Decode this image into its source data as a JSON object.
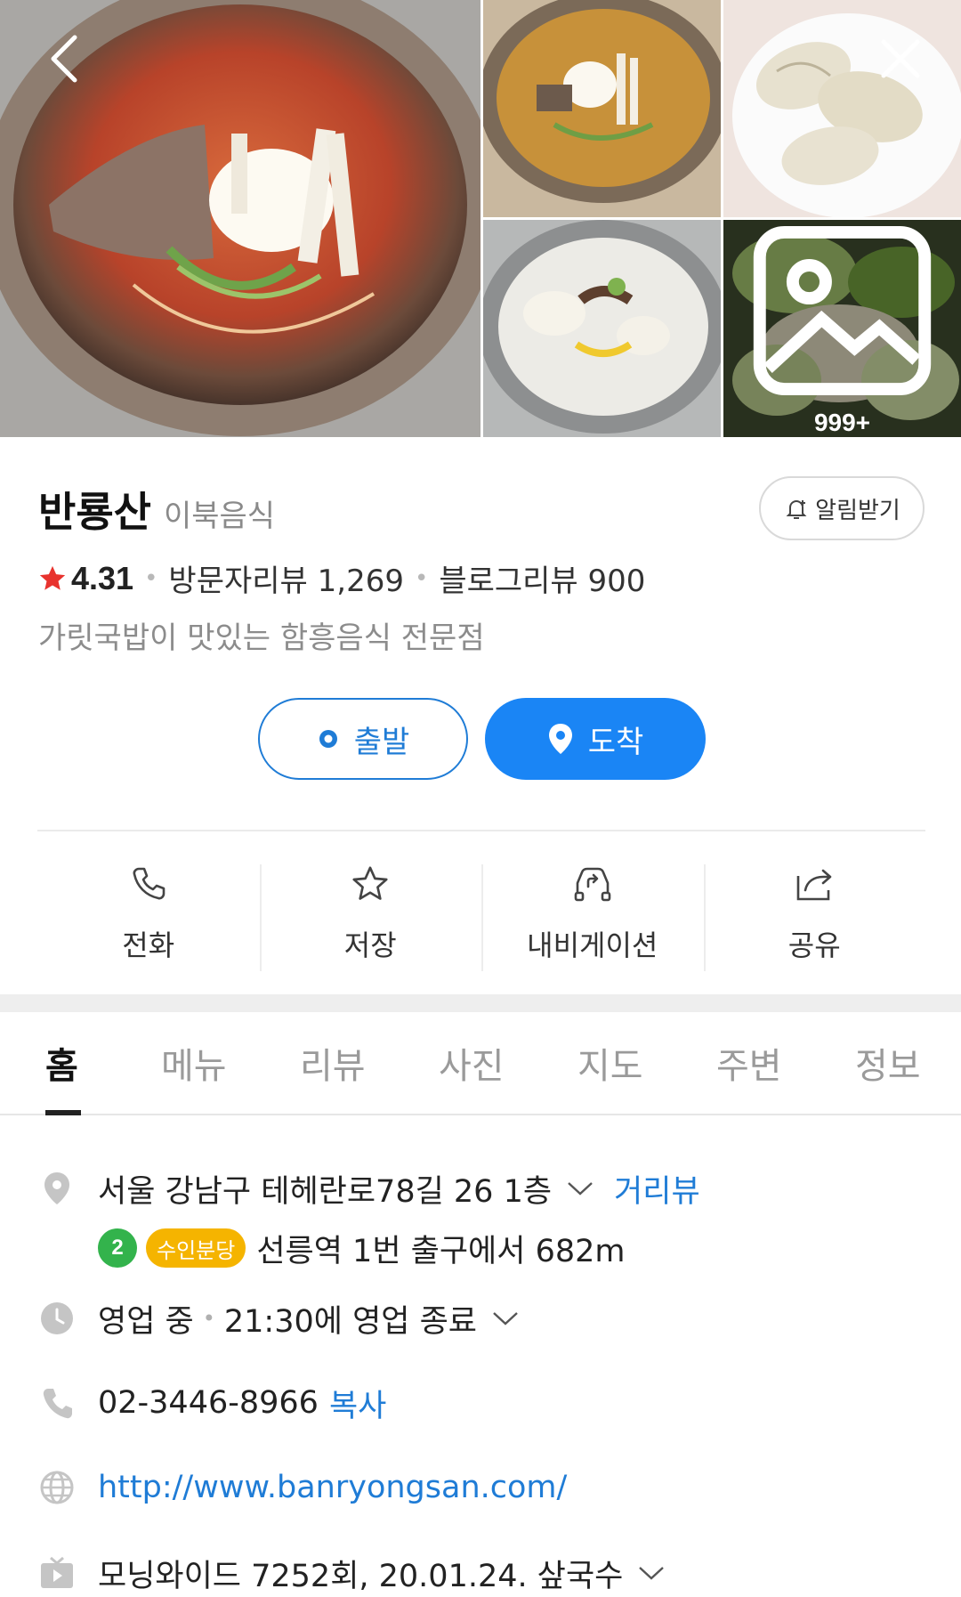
{
  "gallery": {
    "more_count": "999+"
  },
  "place": {
    "name": "반룡산",
    "category": "이북음식",
    "alarm_label": "알림받기",
    "rating": "4.31",
    "visitor_reviews": "방문자리뷰 1,269",
    "blog_reviews": "블로그리뷰 900",
    "description": "가릿국밥이 맛있는 함흥음식 전문점"
  },
  "route": {
    "depart_label": "출발",
    "arrive_label": "도착"
  },
  "actions": [
    {
      "label": "전화",
      "icon": "phone-icon"
    },
    {
      "label": "저장",
      "icon": "star-icon"
    },
    {
      "label": "내비게이션",
      "icon": "car-navigation-icon"
    },
    {
      "label": "공유",
      "icon": "share-icon"
    }
  ],
  "tabs": [
    "홈",
    "메뉴",
    "리뷰",
    "사진",
    "지도",
    "주변",
    "정보"
  ],
  "details": {
    "address": "서울 강남구 테헤란로78길 26 1층",
    "street_view": "거리뷰",
    "subway_line": "2",
    "subway_line_name": "수인분당",
    "subway_direction": "선릉역 1번 출구에서 682m",
    "hours_status": "영업 중",
    "hours_close": "21:30에 영업 종료",
    "phone": "02-3446-8966",
    "copy_label": "복사",
    "website": "http://www.banryongsan.com/",
    "tv": "모닝와이드 7252회, 20.01.24. 샆국수"
  },
  "colors": {
    "accent_blue": "#1a85f5",
    "rating_star": "#e8332e",
    "line2_green": "#33b34c",
    "suin_bundang_yellow": "#f5b400"
  }
}
